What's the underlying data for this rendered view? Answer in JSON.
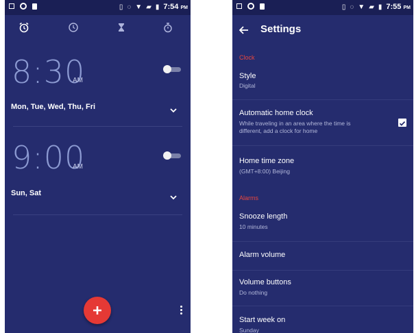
{
  "left": {
    "status": {
      "time": "7:54",
      "ampm": "PM"
    },
    "tabs": [
      "alarm-clock-icon",
      "clock-icon",
      "hourglass-icon",
      "stopwatch-icon"
    ],
    "alarms": [
      {
        "time": "8:30",
        "ampm": "AM",
        "days": "Mon, Tue, Wed, Thu, Fri",
        "enabled": false
      },
      {
        "time": "9:00",
        "ampm": "AM",
        "days": "Sun, Sat",
        "enabled": false
      }
    ]
  },
  "right": {
    "status": {
      "time": "7:55",
      "ampm": "PM"
    },
    "title": "Settings",
    "sections": {
      "clock": "Clock",
      "alarms": "Alarms"
    },
    "items": {
      "style": {
        "title": "Style",
        "value": "Digital"
      },
      "auto_home": {
        "title": "Automatic home clock",
        "desc1": "While traveling in an area where the time is",
        "desc2": "different, add a clock for home",
        "checked": true
      },
      "home_tz": {
        "title": "Home time zone",
        "value": "(GMT+8:00) Beijing"
      },
      "snooze": {
        "title": "Snooze length",
        "value": "10 minutes"
      },
      "alarm_volume": {
        "title": "Alarm volume"
      },
      "volume_buttons": {
        "title": "Volume buttons",
        "value": "Do nothing"
      },
      "start_week": {
        "title": "Start week on",
        "value": "Sunday"
      }
    }
  },
  "colors": {
    "background": "#252c6e",
    "accent": "#e53935",
    "section_header": "#e8463e",
    "time_text": "#8c9ad2"
  }
}
